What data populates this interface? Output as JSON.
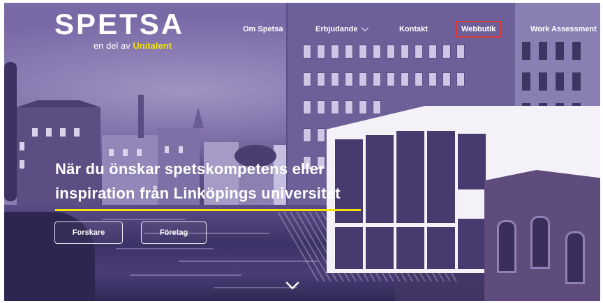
{
  "brand": {
    "name": "SPETSA",
    "tagline_prefix": "en del av ",
    "tagline_brand": "Unitalent"
  },
  "nav": {
    "items": [
      {
        "label": "Om Spetsa"
      },
      {
        "label": "Erbjudande"
      },
      {
        "label": "Kontakt"
      },
      {
        "label": "Webbutik"
      },
      {
        "label": "Work Assessment"
      }
    ]
  },
  "hero": {
    "line1": "När du önskar spetskompetens eller",
    "line2": "inspiration från Linköpings universitet",
    "buttons": [
      {
        "label": "Forskare"
      },
      {
        "label": "Företag"
      }
    ]
  },
  "colors": {
    "accent_yellow": "#f2e400",
    "overlay_purple": "#6b5b98",
    "highlight_red": "#d43a3a"
  },
  "icons": {
    "scroll": "chevron-down-icon",
    "dropdown": "chevron-down-icon"
  }
}
